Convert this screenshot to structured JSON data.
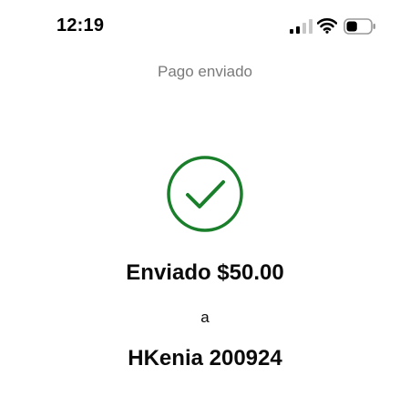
{
  "status_bar": {
    "time": "12:19",
    "signal_icon": "signal-bars-icon",
    "wifi_icon": "wifi-icon",
    "battery_icon": "battery-icon",
    "battery_level": 0.45
  },
  "header": {
    "title": "Pago enviado"
  },
  "confirmation": {
    "icon": "checkmark-circle-icon",
    "accent_color": "#1a7f2a",
    "amount_text": "Enviado $50.00",
    "connector": "a",
    "recipient": "HKenia 200924"
  }
}
